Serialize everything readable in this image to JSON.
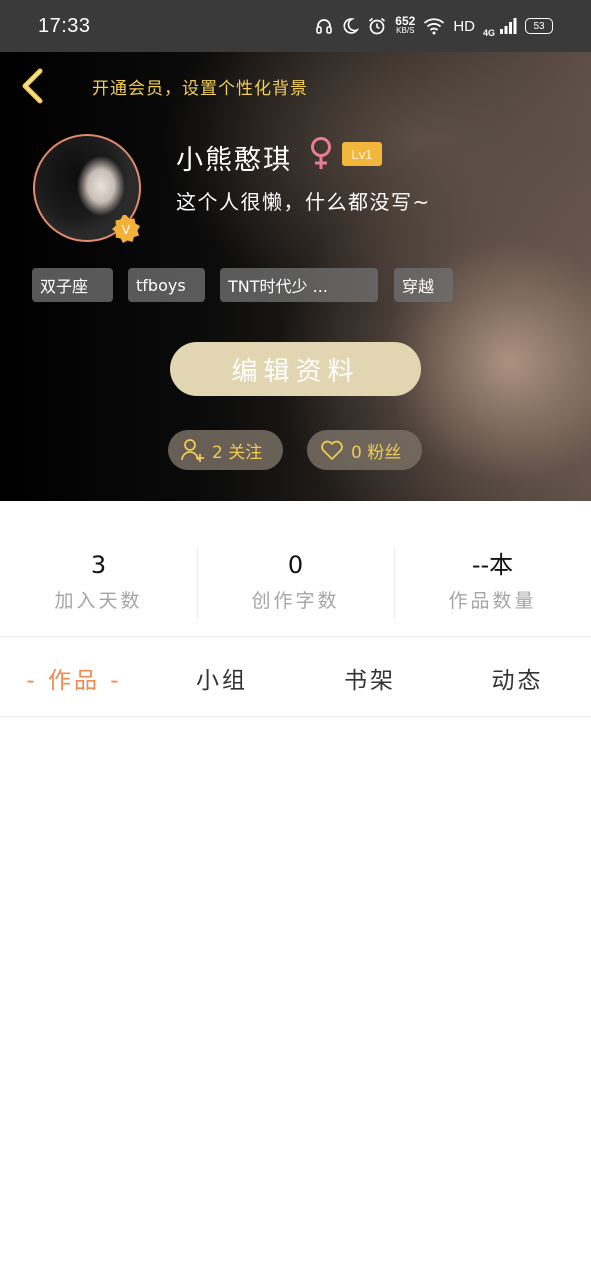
{
  "status_bar": {
    "time": "17:33",
    "speed_value": "652",
    "speed_unit": "KB/S",
    "hd_label": "HD",
    "network_label": "4G",
    "battery": "53"
  },
  "header": {
    "vip_link": "开通会员，设置个性化背景",
    "user_name": "小熊憨琪",
    "gender_symbol": "♀",
    "level": "Lv1",
    "badge_letter": "V",
    "bio": "这个人很懒，什么都没写~",
    "tags": [
      "双子座",
      "tfboys",
      "TNT时代少 ...",
      "穿越"
    ],
    "edit_button": "编辑资料",
    "following": "2 关注",
    "followers": "0 粉丝"
  },
  "stats": [
    {
      "value": "3",
      "label": "加入天数"
    },
    {
      "value": "0",
      "label": "创作字数"
    },
    {
      "value": "--本",
      "label": "作品数量"
    }
  ],
  "tabs": [
    "- 作品 -",
    "小组",
    "书架",
    "动态"
  ],
  "colors": {
    "accent_orange": "#ef8a52",
    "gold": "#f3cf55",
    "edit_button_bg": "#e2d5b2",
    "level_bg": "#f3b63d"
  }
}
